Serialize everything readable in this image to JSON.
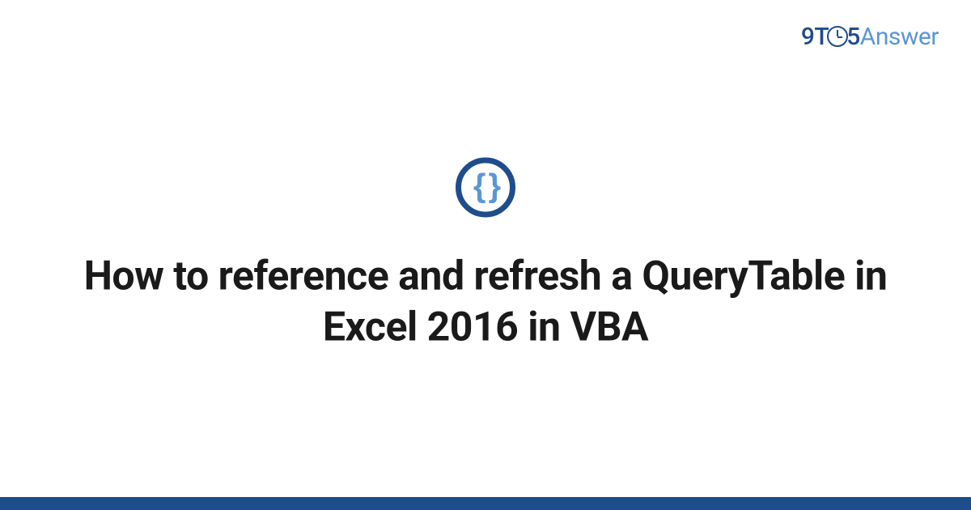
{
  "logo": {
    "part1": "9T",
    "part2": "5",
    "part3": "Answer"
  },
  "icon": {
    "braces": "{ }"
  },
  "title": "How to reference and refresh a QueryTable in Excel 2016 in VBA"
}
